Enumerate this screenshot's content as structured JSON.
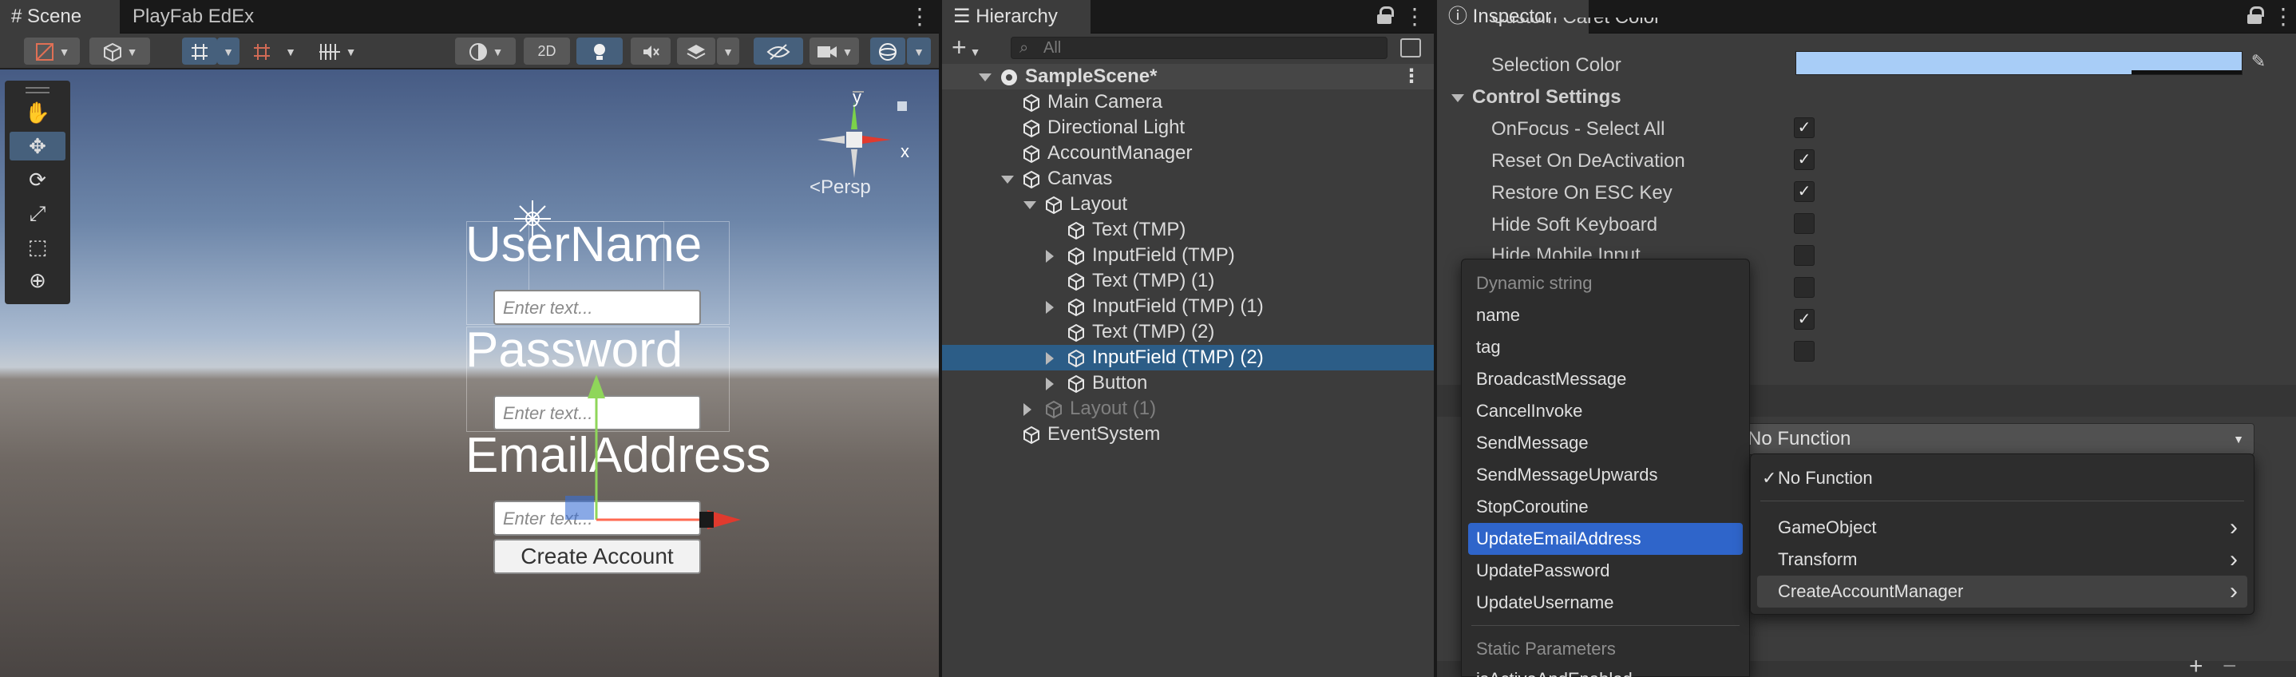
{
  "scene_panel": {
    "tabs": [
      "Scene",
      "PlayFab EdEx"
    ],
    "toolbar": {
      "mode_2d": "2D"
    },
    "persp_label": "<Persp",
    "axis_labels": {
      "y": "y",
      "x": "x"
    },
    "canvas": {
      "username_label": "UserName",
      "password_label": "Password",
      "email_label": "EmailAddress",
      "input_placeholder": "Enter text...",
      "create_button": "Create Account"
    }
  },
  "hierarchy": {
    "tab": "Hierarchy",
    "search_placeholder": "All",
    "items": [
      {
        "label": "SampleScene*",
        "depth": 0,
        "expand": "down",
        "kind": "scene"
      },
      {
        "label": "Main Camera",
        "depth": 1,
        "expand": "none"
      },
      {
        "label": "Directional Light",
        "depth": 1,
        "expand": "none"
      },
      {
        "label": "AccountManager",
        "depth": 1,
        "expand": "none"
      },
      {
        "label": "Canvas",
        "depth": 1,
        "expand": "down"
      },
      {
        "label": "Layout",
        "depth": 2,
        "expand": "down"
      },
      {
        "label": "Text (TMP)",
        "depth": 3,
        "expand": "none"
      },
      {
        "label": "InputField (TMP)",
        "depth": 3,
        "expand": "right"
      },
      {
        "label": "Text (TMP) (1)",
        "depth": 3,
        "expand": "none"
      },
      {
        "label": "InputField (TMP) (1)",
        "depth": 3,
        "expand": "right"
      },
      {
        "label": "Text (TMP) (2)",
        "depth": 3,
        "expand": "none"
      },
      {
        "label": "InputField (TMP) (2)",
        "depth": 3,
        "expand": "right",
        "selected": true
      },
      {
        "label": "Button",
        "depth": 3,
        "expand": "right"
      },
      {
        "label": "Layout (1)",
        "depth": 2,
        "expand": "right",
        "dim": true
      },
      {
        "label": "EventSystem",
        "depth": 1,
        "expand": "none"
      }
    ]
  },
  "inspector": {
    "tab": "Inspector",
    "rows": [
      {
        "label": "Custom Caret Color",
        "check": false
      },
      {
        "label": "Selection Color"
      },
      {
        "label": "Control Settings",
        "header": true
      },
      {
        "label": "OnFocus - Select All",
        "check": true
      },
      {
        "label": "Reset On DeActivation",
        "check": true
      },
      {
        "label": "Restore On ESC Key",
        "check": true
      },
      {
        "label": "Hide Soft Keyboard",
        "check": false
      },
      {
        "label": "Hide Mobile Input",
        "check": false
      }
    ],
    "extra_checks": [
      false,
      true,
      false
    ],
    "function_dropdown": "No Function",
    "selection_color": "#a8cdf7"
  },
  "dynamic_menu": {
    "header": "Dynamic string",
    "items": [
      "name",
      "tag",
      "BroadcastMessage",
      "CancelInvoke",
      "SendMessage",
      "SendMessageUpwards",
      "StopCoroutine",
      "UpdateEmailAddress",
      "UpdatePassword",
      "UpdateUsername"
    ],
    "highlighted": "UpdateEmailAddress",
    "static_header": "Static Parameters",
    "static_first": "isActiveAndEnabled"
  },
  "function_menu": {
    "items": [
      {
        "label": "No Function",
        "checked": true
      },
      {
        "label": "GameObject",
        "submenu": true
      },
      {
        "label": "Transform",
        "submenu": true
      },
      {
        "label": "CreateAccountManager",
        "submenu": true,
        "hover": true
      }
    ]
  },
  "colors": {
    "accent": "#2c5d87",
    "menu_highlight": "#2f65ca",
    "panel_bg": "#3c3c3c"
  }
}
